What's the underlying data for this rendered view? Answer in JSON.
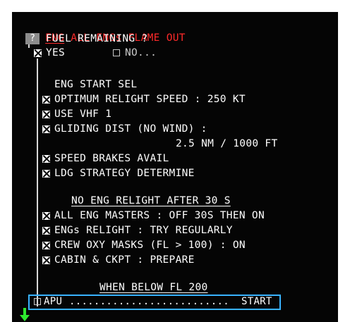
{
  "title": {
    "tag": "ENG",
    "text": "ALL ENGs FLAME OUT"
  },
  "fuel_question": {
    "marker": "?",
    "label": "FUEL REMAINING ?"
  },
  "options": {
    "yes": "YES",
    "no": "NO..."
  },
  "eng_start_sel": "ENG START SEL",
  "items_a": [
    "OPTIMUM RELIGHT SPEED : 250 KT",
    "USE VHF 1",
    "GLIDING DIST (NO WIND) :"
  ],
  "gliding_value": "2.5 NM / 1000 FT",
  "items_b": [
    "SPEED BRAKES AVAIL",
    "LDG STRATEGY DETERMINE"
  ],
  "section_relight": "NO ENG RELIGHT AFTER 30 S",
  "items_c": [
    "ALL ENG MASTERS : OFF 30S THEN ON",
    "ENGs RELIGHT : TRY REGULARLY",
    "CREW OXY MASKS (FL > 100) : ON",
    "CABIN & CKPT : PREPARE"
  ],
  "section_fl200": "WHEN BELOW FL 200",
  "apu": {
    "label": "APU",
    "dots": "..........................",
    "action": "START"
  },
  "colors": {
    "background": "#050505",
    "text": "#ffffff",
    "title": "#ff2a2a",
    "highlight": "#39b3ff",
    "arrow": "#2ee82e"
  }
}
